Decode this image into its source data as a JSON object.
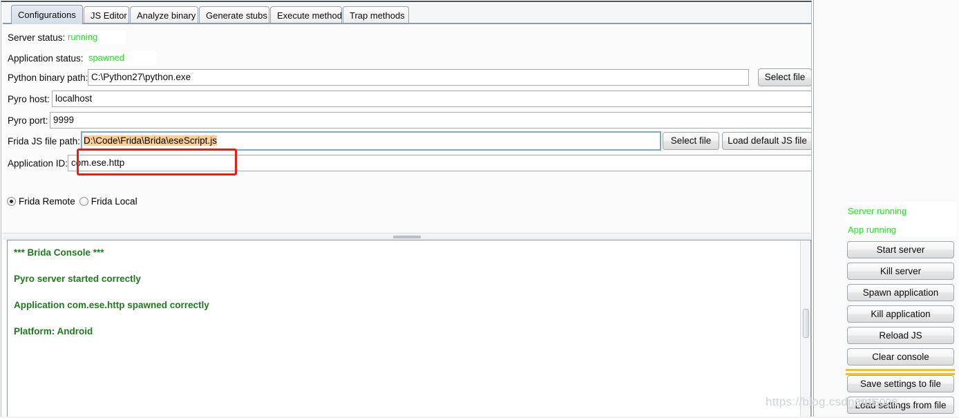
{
  "window": {
    "title": "Brida"
  },
  "tabs": [
    {
      "label": "Configurations",
      "selected": true
    },
    {
      "label": "JS Editor",
      "selected": false
    },
    {
      "label": "Analyze binary",
      "selected": false
    },
    {
      "label": "Generate stubs",
      "selected": false
    },
    {
      "label": "Execute method",
      "selected": false
    },
    {
      "label": "Trap methods",
      "selected": false
    }
  ],
  "form": {
    "server_status_label": "Server status:",
    "server_status_value": "running",
    "application_status_label": "Application status:",
    "application_status_value": "spawned",
    "python_binary_label": "Python binary path:",
    "python_binary_value": "C:\\Python27\\python.exe",
    "python_binary_button": "Select file",
    "pyro_host_label": "Pyro host:",
    "pyro_host_value": "localhost",
    "pyro_port_label": "Pyro port:",
    "pyro_port_value": "9999",
    "frida_js_label": "Frida JS file path:",
    "frida_js_value": "D:\\Code\\Frida\\Brida\\eseScript.js",
    "frida_js_select_button": "Select file",
    "frida_js_load_default_button": "Load default JS file",
    "application_id_label": "Application ID:",
    "application_id_value": "com.ese.http",
    "radio_remote_label": "Frida Remote",
    "radio_local_label": "Frida Local",
    "radio_selected": "remote"
  },
  "console": {
    "lines": [
      "*** Brida Console ***",
      "Pyro server started correctly",
      "Application com.ese.http spawned correctly",
      "Platform: Android"
    ]
  },
  "sidebar": {
    "status": [
      {
        "label": "Server running"
      },
      {
        "label": "App running"
      }
    ],
    "buttons": [
      {
        "label": "Start server"
      },
      {
        "label": "Kill server"
      },
      {
        "label": "Spawn application"
      },
      {
        "label": "Kill application"
      },
      {
        "label": "Reload JS"
      },
      {
        "label": "Clear console"
      }
    ],
    "settings_buttons": [
      {
        "label": "Save settings to file"
      },
      {
        "label": "Load settings from file"
      }
    ]
  },
  "watermark": {
    "url": "https://blog.csdn.net",
    "extra": "_6916008"
  },
  "colors": {
    "status_green": "#15ec15",
    "console_green": "#1e7a1e",
    "highlight_red": "#ee1b11",
    "selection_orange": "#fbcf91",
    "divider_yellow": "#f4c213"
  }
}
